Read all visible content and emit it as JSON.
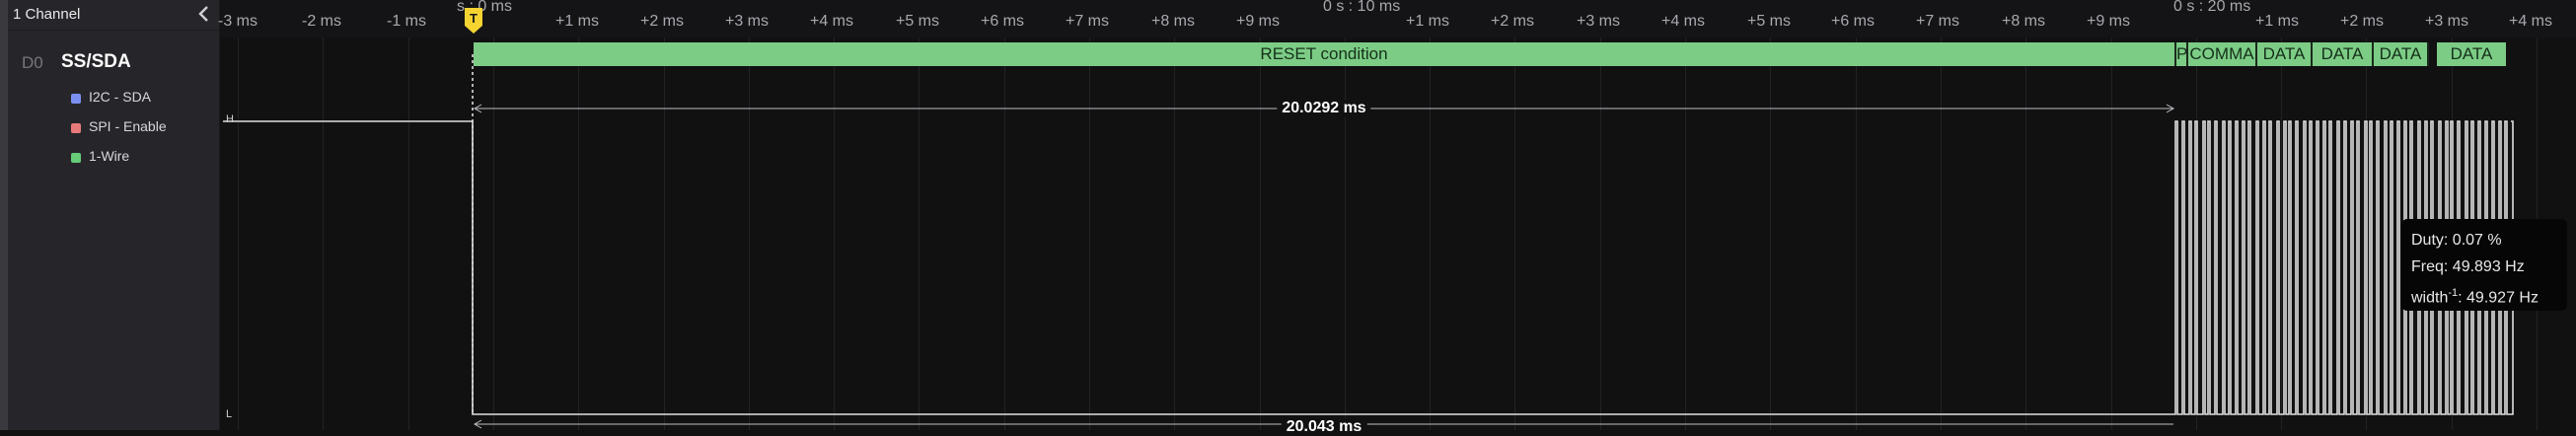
{
  "sidebar": {
    "channel_count_label": "1 Channel",
    "channel": {
      "id": "D0",
      "name": "SS/SDA"
    },
    "analyzers": [
      {
        "label": "I2C - SDA",
        "color": "#7b8ff0"
      },
      {
        "label": "SPI - Enable",
        "color": "#e87a7a"
      },
      {
        "label": "1-Wire",
        "color": "#66cc77"
      }
    ]
  },
  "timeline": {
    "group_labels": [
      "s : 0 ms",
      "0 s : 10 ms",
      "0 s : 20 ms"
    ],
    "ticks": [
      "-3 ms",
      "-2 ms",
      "-1 ms",
      "+1 ms",
      "+2 ms",
      "+3 ms",
      "+4 ms",
      "+5 ms",
      "+6 ms",
      "+7 ms",
      "+8 ms",
      "+9 ms",
      "+1 ms",
      "+2 ms",
      "+3 ms",
      "+4 ms",
      "+5 ms",
      "+6 ms",
      "+7 ms",
      "+8 ms",
      "+9 ms",
      "+1 ms",
      "+2 ms",
      "+3 ms",
      "+4 ms"
    ],
    "trigger_label": "T"
  },
  "decoded": [
    {
      "text": "RESET condition"
    },
    {
      "text": "P"
    },
    {
      "text": "COMMA"
    },
    {
      "text": "DATA"
    },
    {
      "text": "DATA"
    },
    {
      "text": "DATA"
    },
    {
      "text": "DATA"
    }
  ],
  "measurements": {
    "top": "20.0292 ms",
    "bottom": "20.043 ms"
  },
  "levels": {
    "high": "H",
    "low": "L"
  },
  "tooltip": {
    "duty": "Duty: 0.07 %",
    "freq": "Freq: 49.893 Hz",
    "width_prefix": "width",
    "width_sup": "-1",
    "width_value": ": 49.927 Hz"
  },
  "colors": {
    "background": "#111112",
    "sidebar": "#26262a",
    "decode_fill": "#7ccc85",
    "trace": "#e0e0e0",
    "trigger": "#f5d431"
  }
}
